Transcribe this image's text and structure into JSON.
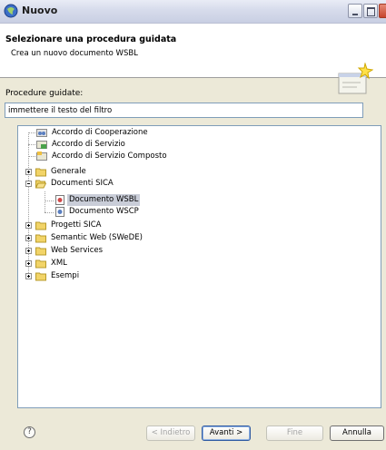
{
  "window": {
    "title": "Nuovo"
  },
  "header": {
    "title": "Selezionare una procedura guidata",
    "description": "Crea un nuovo documento WSBL"
  },
  "filter": {
    "label": "Procedure guidate:",
    "value": "immettere il testo del filtro"
  },
  "tree": {
    "items": [
      {
        "label": "Accordo di Cooperazione",
        "icon": "cooperation-agreement-icon"
      },
      {
        "label": "Accordo di Servizio",
        "icon": "service-agreement-icon"
      },
      {
        "label": "Accordo di Servizio Composto",
        "icon": "composite-service-agreement-icon"
      },
      {
        "label": "Generale",
        "icon": "folder-icon",
        "expanded": false
      },
      {
        "label": "Documenti SICA",
        "icon": "folder-icon",
        "expanded": true
      },
      {
        "label": "Documento WSBL",
        "icon": "document-icon",
        "selected": true
      },
      {
        "label": "Documento WSCP",
        "icon": "document-icon"
      },
      {
        "label": "Progetti SICA",
        "icon": "folder-icon",
        "expanded": false
      },
      {
        "label": "Semantic Web (SWeDE)",
        "icon": "folder-icon",
        "expanded": false
      },
      {
        "label": "Web Services",
        "icon": "folder-icon",
        "expanded": false
      },
      {
        "label": "XML",
        "icon": "folder-icon",
        "expanded": false
      },
      {
        "label": "Esempi",
        "icon": "folder-icon",
        "expanded": false
      }
    ]
  },
  "buttons": {
    "help": "?",
    "back": "< Indietro",
    "next": "Avanti >",
    "finish": "Fine",
    "cancel": "Annulla"
  },
  "colors": {
    "selection": "#c9cdd8",
    "folder": "#f2d468",
    "input_border": "#7f9db9"
  }
}
